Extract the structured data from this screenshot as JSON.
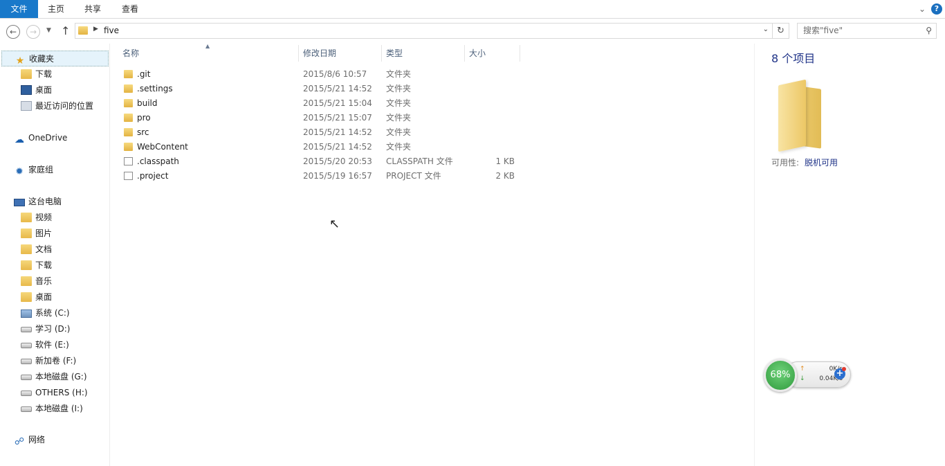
{
  "ribbon": {
    "tabs": [
      "文件",
      "主页",
      "共享",
      "查看"
    ],
    "help_label": "?"
  },
  "address": {
    "path_segment": "five",
    "search_placeholder": "搜索\"five\""
  },
  "nav_pane": {
    "favorites": "收藏夹",
    "favorite_items": [
      "下载",
      "桌面",
      "最近访问的位置"
    ],
    "onedrive": "OneDrive",
    "homegroup": "家庭组",
    "this_pc": "这台电脑",
    "pc_items": [
      "视频",
      "图片",
      "文档",
      "下载",
      "音乐",
      "桌面"
    ],
    "drives": [
      "系统 (C:)",
      "学习 (D:)",
      "软件 (E:)",
      "新加卷 (F:)",
      "本地磁盘 (G:)",
      "OTHERS (H:)",
      "本地磁盘 (I:)"
    ],
    "network": "网络"
  },
  "file_list": {
    "columns": [
      "名称",
      "修改日期",
      "类型",
      "大小"
    ],
    "rows": [
      {
        "name": ".git",
        "date": "2015/8/6 10:57",
        "type": "文件夹",
        "size": "",
        "kind": "folder"
      },
      {
        "name": ".settings",
        "date": "2015/5/21 14:52",
        "type": "文件夹",
        "size": "",
        "kind": "folder"
      },
      {
        "name": "build",
        "date": "2015/5/21 15:04",
        "type": "文件夹",
        "size": "",
        "kind": "folder"
      },
      {
        "name": "pro",
        "date": "2015/5/21 15:07",
        "type": "文件夹",
        "size": "",
        "kind": "folder"
      },
      {
        "name": "src",
        "date": "2015/5/21 14:52",
        "type": "文件夹",
        "size": "",
        "kind": "folder"
      },
      {
        "name": "WebContent",
        "date": "2015/5/21 14:52",
        "type": "文件夹",
        "size": "",
        "kind": "folder"
      },
      {
        "name": ".classpath",
        "date": "2015/5/20 20:53",
        "type": "CLASSPATH 文件",
        "size": "1 KB",
        "kind": "file"
      },
      {
        "name": ".project",
        "date": "2015/5/19 16:57",
        "type": "PROJECT 文件",
        "size": "2 KB",
        "kind": "file"
      }
    ]
  },
  "details": {
    "count": "8 个项目",
    "availability_label": "可用性:",
    "availability_value": "脱机可用"
  },
  "widget": {
    "percent": "68%",
    "up_speed": "0K/s",
    "down_speed": "0.04K/s"
  },
  "colors": {
    "file_tab": "#1979ca",
    "accent_text": "#1e3287",
    "header_text": "#4c607a",
    "widget_green": "#2f9a3c"
  }
}
